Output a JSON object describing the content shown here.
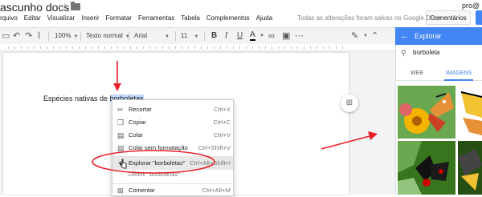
{
  "doc": {
    "title": "ascunho docs",
    "user": "pro@"
  },
  "menus": [
    "rquivo",
    "Editar",
    "Visualizar",
    "Inserir",
    "Formatar",
    "Ferramentas",
    "Tabela",
    "Complementos",
    "Ajuda"
  ],
  "status": {
    "saved": "Todas as alterações foram salvas no Google Drive"
  },
  "buttons": {
    "comments": "Comentários"
  },
  "toolbar": {
    "zoom": "100%",
    "style": "Texto normal",
    "font": "Arial",
    "size": "11"
  },
  "page": {
    "text_before": "Espécies nativas de ",
    "text_selected": "borboletas"
  },
  "context_menu": [
    {
      "icon": "scissors-icon",
      "label": "Recortar",
      "shortcut": "Ctrl+X"
    },
    {
      "icon": "copy-icon",
      "label": "Copiar",
      "shortcut": "Ctrl+C"
    },
    {
      "icon": "paste-icon",
      "label": "Colar",
      "shortcut": "Ctrl+V"
    },
    {
      "icon": "paste-plain-icon",
      "label": "Colar sem formatação",
      "shortcut": "Ctrl+Shift+V"
    },
    {
      "icon": "explore-icon",
      "label": "Explorar \"borboletas\"",
      "shortcut": "Ctrl+Alt+Shift+I"
    },
    {
      "icon": "",
      "label": "Definir \"borboletas\"",
      "shortcut": ""
    },
    {
      "icon": "comment-icon",
      "label": "Comentar",
      "shortcut": "Ctrl+Alt+M"
    }
  ],
  "explore": {
    "title": "Explorar",
    "query": "borboleta",
    "tabs": [
      "WEB",
      "IMAGENS"
    ],
    "active_tab": "IMAGENS"
  },
  "colors": {
    "accent": "#4285f4",
    "annotation": "#e8202a"
  }
}
